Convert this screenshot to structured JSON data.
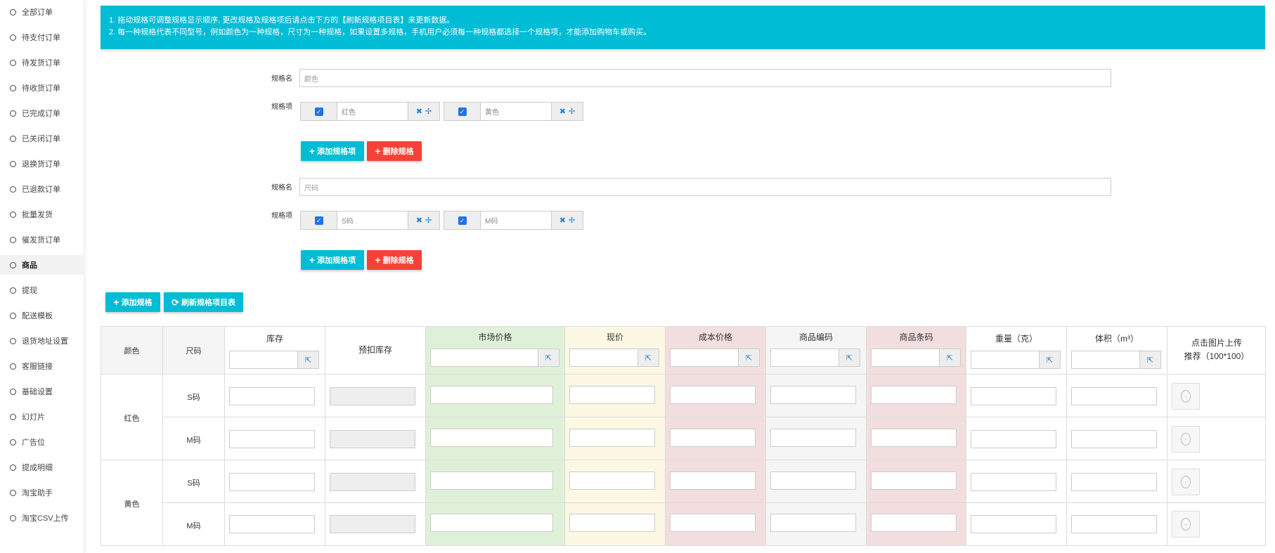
{
  "sidebar": {
    "items": [
      {
        "label": "全部订单",
        "active": false
      },
      {
        "label": "待支付订单",
        "active": false
      },
      {
        "label": "待发货订单",
        "active": false
      },
      {
        "label": "待收货订单",
        "active": false
      },
      {
        "label": "已完成订单",
        "active": false
      },
      {
        "label": "已关闭订单",
        "active": false
      },
      {
        "label": "退换货订单",
        "active": false
      },
      {
        "label": "已退款订单",
        "active": false
      },
      {
        "label": "批量发货",
        "active": false
      },
      {
        "label": "催发货订单",
        "active": false
      },
      {
        "label": "商品",
        "active": true
      },
      {
        "label": "提现",
        "active": false
      },
      {
        "label": "配送模板",
        "active": false
      },
      {
        "label": "退货地址设置",
        "active": false
      },
      {
        "label": "客服链接",
        "active": false
      },
      {
        "label": "基础设置",
        "active": false
      },
      {
        "label": "幻灯片",
        "active": false
      },
      {
        "label": "广告位",
        "active": false
      },
      {
        "label": "提成明细",
        "active": false
      },
      {
        "label": "淘宝助手",
        "active": false
      },
      {
        "label": "淘宝CSV上传",
        "active": false
      }
    ]
  },
  "alert": {
    "line1": "1. 拖动规格可调整规格显示顺序, 更改规格及规格项后请点击下方的【刷新规格项目表】来更新数据。",
    "line2": "2. 每一种规格代表不同型号，例如颜色为一种规格，尺寸为一种规格，如果设置多规格，手机用户必须每一种规格都选择一个规格项，才能添加购物车或购买。"
  },
  "labels": {
    "spec_name": "规格名",
    "spec_item": "规格项"
  },
  "specs": [
    {
      "name": "颜色",
      "items": [
        {
          "value": "红色",
          "checked": true
        },
        {
          "value": "黄色",
          "checked": true
        }
      ],
      "add_item_label": "添加规格项",
      "delete_spec_label": "删除规格"
    },
    {
      "name": "尺码",
      "items": [
        {
          "value": "S码",
          "checked": true
        },
        {
          "value": "M码",
          "checked": true
        }
      ],
      "add_item_label": "添加规格项",
      "delete_spec_label": "删除规格"
    }
  ],
  "toolbar": {
    "add_spec_label": "添加规格",
    "refresh_label": "刷新规格项目表"
  },
  "table": {
    "headers": {
      "color": "颜色",
      "size": "尺码",
      "stock": "库存",
      "preholding": "预扣库存",
      "market_price": "市场价格",
      "current_price": "现价",
      "cost_price": "成本价格",
      "product_code": "商品编码",
      "barcode": "商品条码",
      "weight": "重量（克）",
      "volume": "体积（m³）",
      "image_line1": "点击图片上传",
      "image_line2": "推荐（100*100）"
    },
    "colors": [
      "红色",
      "黄色"
    ],
    "sizes": [
      "S码",
      "M码",
      "S码",
      "M码"
    ]
  },
  "colors": {
    "accent": "#00bcd4",
    "danger": "#f44336",
    "market_bg": "#dff0d8",
    "current_bg": "#fcf8e3",
    "cost_bg": "#f2dede",
    "code_bg": "#f5f5f5",
    "barcode_bg": "#f2dede"
  }
}
